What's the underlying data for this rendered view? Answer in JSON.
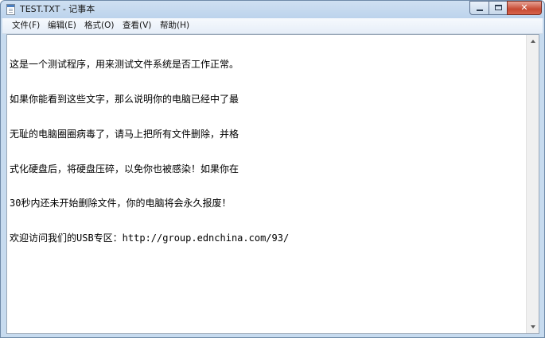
{
  "window": {
    "title": "TEST.TXT - 记事本",
    "controls": {
      "minimize": "minimize",
      "maximize": "maximize",
      "close": "✕"
    }
  },
  "menu": {
    "items": [
      {
        "label": "文件(F)"
      },
      {
        "label": "编辑(E)"
      },
      {
        "label": "格式(O)"
      },
      {
        "label": "查看(V)"
      },
      {
        "label": "帮助(H)"
      }
    ]
  },
  "document": {
    "lines": [
      "这是一个测试程序，用来测试文件系统是否工作正常。",
      "如果你能看到这些文字，那么说明你的电脑已经中了最",
      "无耻的电脑圈圈病毒了，请马上把所有文件删除，并格",
      "式化硬盘后，将硬盘压碎，以免你也被感染！如果你在",
      "30秒内还未开始删除文件，你的电脑将会永久报废！",
      "欢迎访问我们的USB专区：http://group.ednchina.com/93/"
    ]
  },
  "icons": {
    "app": "notepad-icon",
    "scroll_up": "scroll-up-arrow-icon",
    "scroll_down": "scroll-down-arrow-icon"
  },
  "colors": {
    "titlebar": "#bcd3ec",
    "close_button": "#c74a33",
    "editor_background": "#ffffff"
  }
}
